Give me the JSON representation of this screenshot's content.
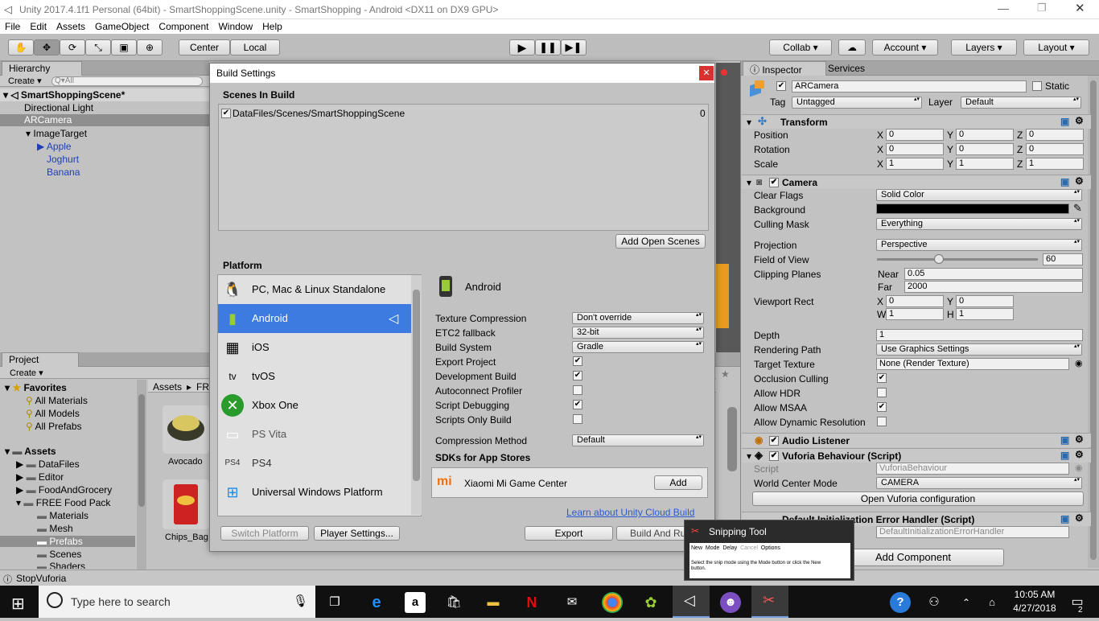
{
  "window": {
    "title": "Unity 2017.4.1f1 Personal (64bit) - SmartShoppingScene.unity - SmartShopping - Android <DX11 on DX9 GPU>"
  },
  "menu": [
    "File",
    "Edit",
    "Assets",
    "GameObject",
    "Component",
    "Window",
    "Help"
  ],
  "toolbar": {
    "center": "Center",
    "local": "Local",
    "collab": "Collab",
    "account": "Account",
    "layers": "Layers",
    "layout": "Layout"
  },
  "hierarchy": {
    "tab": "Hierarchy",
    "create": "Create",
    "search_placeholder": "Q▾All",
    "scene": "SmartShoppingScene*",
    "items": [
      "Directional Light",
      "ARCamera",
      "ImageTarget",
      "Apple",
      "Joghurt",
      "Banana"
    ]
  },
  "project": {
    "tab": "Project",
    "create": "Create",
    "favorites": "Favorites",
    "fav_items": [
      "All Materials",
      "All Models",
      "All Prefabs"
    ],
    "assets": "Assets",
    "folders": [
      "DataFiles",
      "Editor",
      "FoodAndGrocery",
      "FREE Food Pack",
      "Materials",
      "Mesh",
      "Prefabs",
      "Scenes",
      "Shaders"
    ],
    "breadcrumb": [
      "Assets",
      "FRE"
    ],
    "thumbs": [
      "Avocado",
      "Chips_Bag"
    ]
  },
  "status": {
    "text": "StopVuforia"
  },
  "build": {
    "title": "Build Settings",
    "scenes_heading": "Scenes In Build",
    "scene_path": "DataFiles/Scenes/SmartShoppingScene",
    "scene_index": "0",
    "add_open_scenes": "Add Open Scenes",
    "platform_heading": "Platform",
    "platforms": [
      "PC, Mac & Linux Standalone",
      "Android",
      "iOS",
      "tvOS",
      "Xbox One",
      "PS Vita",
      "PS4",
      "Universal Windows Platform"
    ],
    "selected": "Android",
    "settings": {
      "labels": [
        "Texture Compression",
        "ETC2 fallback",
        "Build System",
        "Export Project",
        "Development Build",
        "Autoconnect Profiler",
        "Script Debugging",
        "Scripts Only Build",
        "Compression Method"
      ],
      "texture_compression": "Don't override",
      "etc2": "32-bit",
      "build_system": "Gradle",
      "compression": "Default"
    },
    "sdks_heading": "SDKs for App Stores",
    "sdk_name": "Xiaomi Mi Game Center",
    "add": "Add",
    "cloud_link": "Learn about Unity Cloud Build",
    "switch": "Switch Platform",
    "player": "Player Settings...",
    "export": "Export",
    "build_run": "Build And Run"
  },
  "inspector": {
    "tab": "Inspector",
    "services": "Services",
    "name": "ARCamera",
    "static": "Static",
    "tag_label": "Tag",
    "tag": "Untagged",
    "layer_label": "Layer",
    "layer": "Default",
    "transform": {
      "title": "Transform",
      "position": "Position",
      "rotation": "Rotation",
      "scale": "Scale",
      "pos": [
        "0",
        "0",
        "0"
      ],
      "rot": [
        "0",
        "0",
        "0"
      ],
      "scl": [
        "1",
        "1",
        "1"
      ]
    },
    "camera": {
      "title": "Camera",
      "labels": [
        "Clear Flags",
        "Background",
        "Culling Mask",
        "Projection",
        "Field of View",
        "Clipping Planes",
        "Viewport Rect",
        "Depth",
        "Rendering Path",
        "Target Texture",
        "Occlusion Culling",
        "Allow HDR",
        "Allow MSAA",
        "Allow Dynamic Resolution"
      ],
      "clear_flags": "Solid Color",
      "culling": "Everything",
      "projection": "Perspective",
      "fov": "60",
      "fov_fraction": 0.385,
      "near_label": "Near",
      "near": "0.05",
      "far_label": "Far",
      "far": "2000",
      "vx": "0",
      "vy": "0",
      "vw": "1",
      "vh": "1",
      "depth": "1",
      "render_path": "Use Graphics Settings",
      "target": "None (Render Texture)"
    },
    "audio": "Audio Listener",
    "vuforia": {
      "title": "Vuforia Behaviour (Script)",
      "script_label": "Script",
      "script": "VuforiaBehaviour",
      "wcm_label": "World Center Mode",
      "wcm": "CAMERA",
      "config": "Open Vuforia configuration"
    },
    "error_handler": {
      "title": "Default Initialization Error Handler (Script)",
      "script": "DefaultInitializationErrorHandler"
    },
    "add_component": "Add Component"
  },
  "snip": {
    "title": "Snipping Tool",
    "new": "New",
    "mode": "Mode",
    "delay": "Delay",
    "cancel": "Cancel",
    "options": "Options",
    "desc": "Select the snip mode using the Mode button or click the New button."
  },
  "taskbar": {
    "search": "Type here to search",
    "time": "10:05 AM",
    "date": "4/27/2018",
    "notif": "2"
  }
}
